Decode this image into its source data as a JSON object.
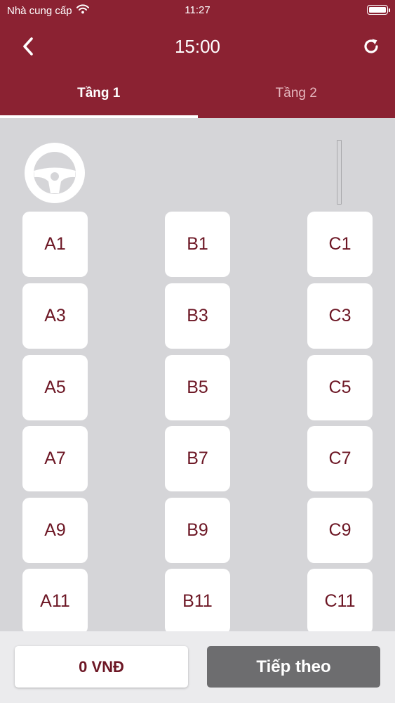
{
  "status_bar": {
    "carrier": "Nhà cung cấp",
    "time": "11:27"
  },
  "header": {
    "title": "15:00"
  },
  "tabs": [
    {
      "label": "Tầng 1",
      "active": true
    },
    {
      "label": "Tầng 2",
      "active": false
    }
  ],
  "seats": {
    "column_a": [
      "A1",
      "A3",
      "A5",
      "A7",
      "A9",
      "A11"
    ],
    "column_b": [
      "B1",
      "B3",
      "B5",
      "B7",
      "B9",
      "B11"
    ],
    "column_c": [
      "C1",
      "C3",
      "C5",
      "C7",
      "C9",
      "C11"
    ]
  },
  "footer": {
    "price": "0 VNĐ",
    "next_label": "Tiếp theo"
  },
  "icons": {
    "back": "chevron-left-icon",
    "refresh": "refresh-icon",
    "steering": "steering-wheel-icon",
    "wifi": "wifi-icon",
    "battery": "battery-icon"
  },
  "colors": {
    "brand": "#8b2232",
    "seat_text": "#6c1624",
    "seat_area_background": "#d5d5d8",
    "next_button": "#6d6d6f"
  }
}
